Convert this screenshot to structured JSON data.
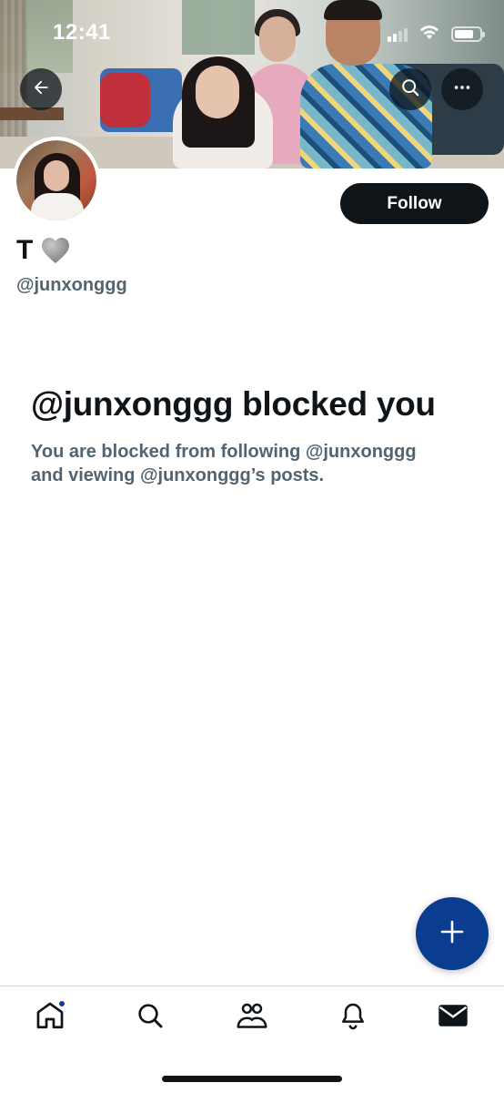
{
  "status_bar": {
    "time": "12:41"
  },
  "header": {
    "back_icon": "arrow-left-icon",
    "search_icon": "search-icon",
    "more_icon": "more-horizontal-icon"
  },
  "profile": {
    "display_name": "T",
    "name_emoji": "grey-heart-icon",
    "handle": "@junxonggg",
    "follow_label": "Follow"
  },
  "blocked": {
    "title": "@junxonggg blocked you",
    "line1": "You are blocked from following @junxonggg",
    "line2": "and viewing @junxonggg’s posts."
  },
  "fab": {
    "icon": "plus-icon"
  },
  "bottom_nav": {
    "items": [
      {
        "icon": "home-icon",
        "has_badge": true
      },
      {
        "icon": "search-icon"
      },
      {
        "icon": "communities-icon"
      },
      {
        "icon": "bell-icon"
      },
      {
        "icon": "mail-icon"
      }
    ]
  },
  "colors": {
    "primary_text": "#0f1419",
    "secondary_text": "#536471",
    "accent": "#0a3d8f",
    "follow_bg": "#0f1419"
  }
}
